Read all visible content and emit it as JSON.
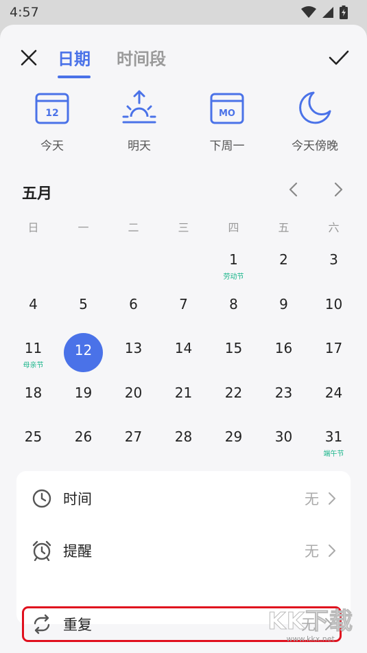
{
  "status_bar": {
    "time": "4:57"
  },
  "header": {
    "tab_active": "日期",
    "tab_inactive": "时间段"
  },
  "quick": [
    {
      "label": "今天",
      "icon": "calendar-today-icon",
      "icon_text": "12"
    },
    {
      "label": "明天",
      "icon": "sunrise-icon"
    },
    {
      "label": "下周一",
      "icon": "calendar-monday-icon",
      "icon_text": "MO"
    },
    {
      "label": "今天傍晚",
      "icon": "moon-icon"
    }
  ],
  "calendar": {
    "month": "五月",
    "weekdays": [
      "日",
      "一",
      "二",
      "三",
      "四",
      "五",
      "六"
    ],
    "selected_day": "12",
    "weeks": [
      [
        {
          "d": ""
        },
        {
          "d": ""
        },
        {
          "d": ""
        },
        {
          "d": ""
        },
        {
          "d": "1",
          "h": "劳动节"
        },
        {
          "d": "2"
        },
        {
          "d": "3"
        }
      ],
      [
        {
          "d": "4"
        },
        {
          "d": "5"
        },
        {
          "d": "6"
        },
        {
          "d": "7"
        },
        {
          "d": "8"
        },
        {
          "d": "9"
        },
        {
          "d": "10"
        }
      ],
      [
        {
          "d": "11",
          "h": "母亲节"
        },
        {
          "d": "12"
        },
        {
          "d": "13"
        },
        {
          "d": "14"
        },
        {
          "d": "15"
        },
        {
          "d": "16"
        },
        {
          "d": "17"
        }
      ],
      [
        {
          "d": "18"
        },
        {
          "d": "19"
        },
        {
          "d": "20"
        },
        {
          "d": "21"
        },
        {
          "d": "22"
        },
        {
          "d": "23"
        },
        {
          "d": "24"
        }
      ],
      [
        {
          "d": "25"
        },
        {
          "d": "26"
        },
        {
          "d": "27"
        },
        {
          "d": "28"
        },
        {
          "d": "29"
        },
        {
          "d": "30"
        },
        {
          "d": "31",
          "h": "端午节"
        }
      ]
    ]
  },
  "settings": {
    "time": {
      "label": "时间",
      "value": "无"
    },
    "reminder": {
      "label": "提醒",
      "value": "无"
    },
    "repeat": {
      "label": "重复",
      "value": "无"
    }
  },
  "watermark": {
    "text": "KK下载",
    "url": "www.kkx.net"
  },
  "colors": {
    "accent": "#4a72e8",
    "holiday": "#19b58a",
    "highlight": "#e0101e"
  }
}
